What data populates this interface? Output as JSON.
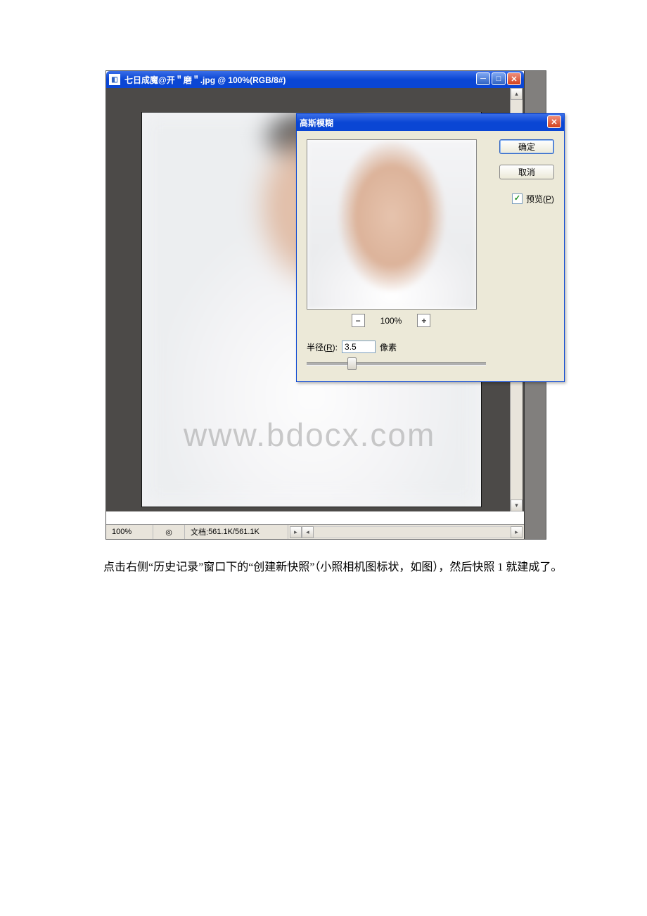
{
  "main_window": {
    "title": "七日成魔@开＂磨＂.jpg @ 100%(RGB/8#)"
  },
  "watermark": "www.bdocx.com",
  "status": {
    "zoom": "100%",
    "doc_label": "文档:",
    "doc_size": "561.1K/561.1K"
  },
  "dialog": {
    "title": "高斯模糊",
    "ok": "确定",
    "cancel": "取消",
    "preview_label": "预览(P)",
    "preview_accel": "P",
    "zoom_value": "100%",
    "radius_label": "半径(R):",
    "radius_accel": "R",
    "radius_value": "3.5",
    "radius_unit": "像素"
  },
  "caption": "点击右侧“历史记录”窗口下的“创建新快照”（小照相机图标状，如图），然后快照 1 就建成了。"
}
